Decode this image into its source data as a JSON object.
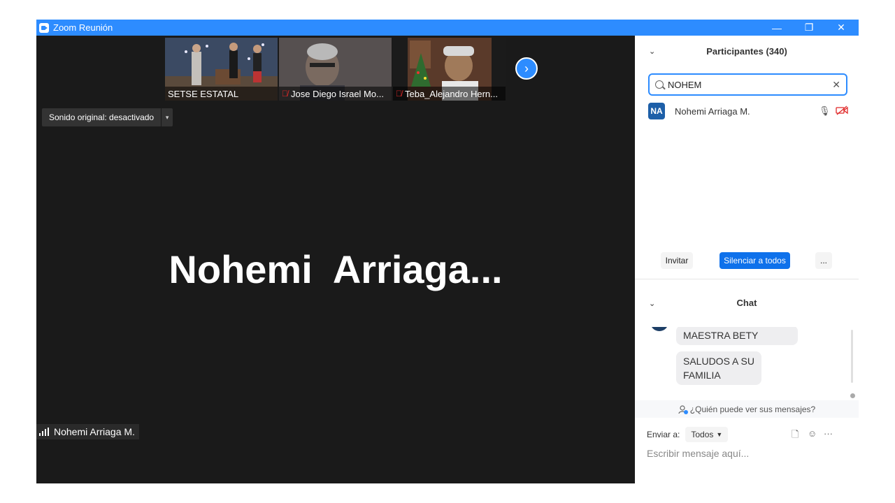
{
  "window": {
    "title": "Zoom Reunión",
    "minimize": "—",
    "restore": "❐",
    "close": "✕"
  },
  "thumbnails": [
    {
      "name": "SETSE ESTATAL",
      "muted": false
    },
    {
      "name": "Jose Diego Israel Mo...",
      "muted": true
    },
    {
      "name": "Teba_Alejandro Hern...",
      "muted": true
    }
  ],
  "next_button": "›",
  "sound_original": {
    "label": "Sonido original: desactivado",
    "dropdown": "▾"
  },
  "speaker": {
    "big_name": "Nohemi  Arriaga...",
    "chip_name": "Nohemi Arriaga M."
  },
  "participants": {
    "title": "Participantes (340)",
    "collapse_icon": "⌄",
    "search_value": "NOHEM",
    "clear_icon": "✕",
    "list": [
      {
        "initials": "NA",
        "name": "Nohemi Arriaga M."
      }
    ],
    "buttons": {
      "invite": "Invitar",
      "mute_all": "Silenciar a todos",
      "more": "..."
    }
  },
  "chat": {
    "title": "Chat",
    "messages": [
      "MAESTRA BETY",
      "SALUDOS A SU\nFAMILIA"
    ],
    "who_can_see": "¿Quién puede ver sus mensajes?",
    "send_to_label": "Enviar a:",
    "send_to_value": "Todos",
    "input_placeholder": "Escribir mensaje aquí..."
  },
  "colors": {
    "accent": "#2d8cff",
    "button_blue": "#0e71eb",
    "meeting_bg": "#1a1a1a",
    "muted_red": "#e02828"
  }
}
